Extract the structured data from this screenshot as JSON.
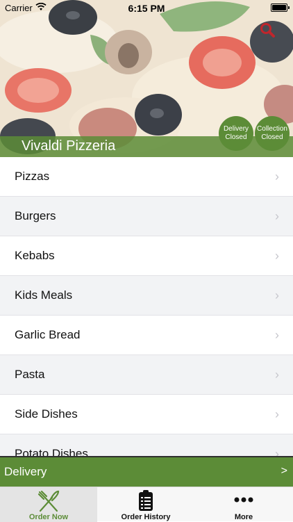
{
  "status_bar": {
    "carrier": "Carrier",
    "time": "6:15 PM"
  },
  "header": {
    "restaurant_name": "Vivaldi Pizzeria",
    "delivery_status": {
      "line1": "Delivery",
      "line2": "Closed"
    },
    "collection_status": {
      "line1": "Collection",
      "line2": "Closed"
    },
    "search_icon": "search-icon"
  },
  "menu": {
    "items": [
      {
        "label": "Pizzas"
      },
      {
        "label": "Burgers"
      },
      {
        "label": "Kebabs"
      },
      {
        "label": "Kids Meals"
      },
      {
        "label": "Garlic Bread"
      },
      {
        "label": "Pasta"
      },
      {
        "label": "Side Dishes"
      },
      {
        "label": "Potato Dishes"
      }
    ],
    "chevron": "›"
  },
  "delivery_bar": {
    "label": "Delivery",
    "arrow": ">"
  },
  "tabbar": {
    "tabs": [
      {
        "label": "Order Now",
        "icon": "fork-knife-icon"
      },
      {
        "label": "Order History",
        "icon": "clipboard-icon"
      },
      {
        "label": "More",
        "icon": "more-dots-icon"
      }
    ]
  },
  "colors": {
    "brand_green": "#5c8c37",
    "search_red": "#c0262c"
  }
}
